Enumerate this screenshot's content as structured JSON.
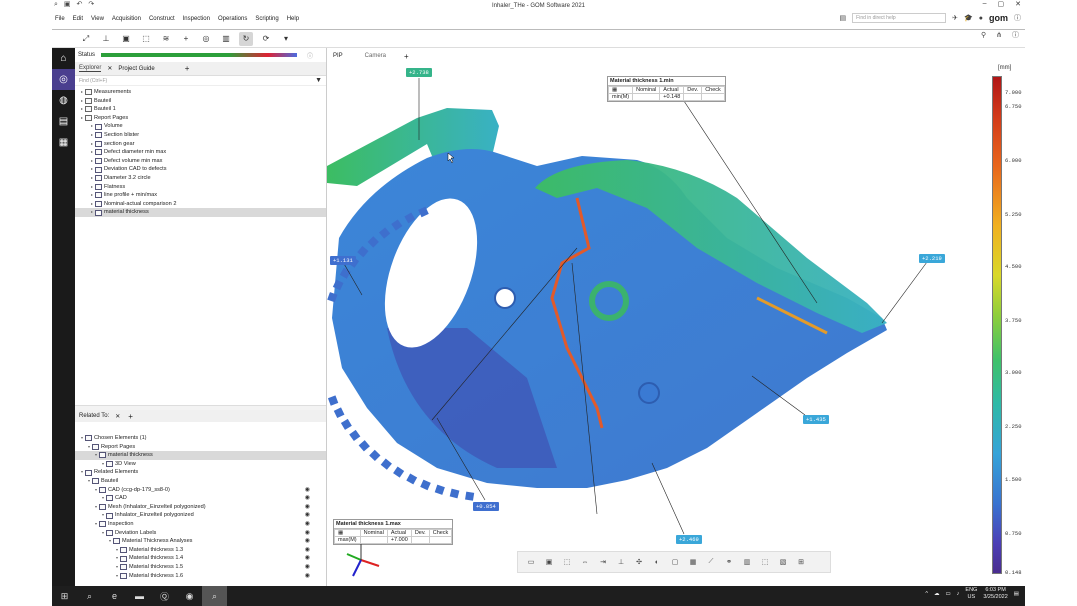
{
  "window": {
    "title": "Inhaler_THe - GOM Software 2021"
  },
  "menu": {
    "items": [
      "File",
      "Edit",
      "View",
      "Acquisition",
      "Construct",
      "Inspection",
      "Operations",
      "Scripting",
      "Help"
    ],
    "search_placeholder": "Find in direct help",
    "logo": "gom"
  },
  "status": {
    "label": "Status"
  },
  "tabs": {
    "explorer": "Explorer",
    "project_guide": "Project Guide"
  },
  "find": {
    "placeholder": "Find (Ctrl+F)"
  },
  "explorer_tree": [
    {
      "label": "Measurements",
      "level": 0
    },
    {
      "label": "Bauteil",
      "level": 0
    },
    {
      "label": "Bauteil 1",
      "level": 0
    },
    {
      "label": "Report Pages",
      "level": 0
    },
    {
      "label": "Volume",
      "level": 1
    },
    {
      "label": "Section blister",
      "level": 1
    },
    {
      "label": "section gear",
      "level": 1
    },
    {
      "label": "Defect diameter min max",
      "level": 1
    },
    {
      "label": "Defect volume min max",
      "level": 1
    },
    {
      "label": "Deviation CAD to defects",
      "level": 1
    },
    {
      "label": "Diameter 3.2 circle",
      "level": 1
    },
    {
      "label": "Flatness",
      "level": 1
    },
    {
      "label": "line profile + min/max",
      "level": 1
    },
    {
      "label": "Nominal-actual comparison 2",
      "level": 1
    },
    {
      "label": "material thickness",
      "level": 1,
      "selected": true
    }
  ],
  "related": {
    "title": "Related To:"
  },
  "related_tree": [
    {
      "label": "Chosen Elements (1)",
      "level": 0
    },
    {
      "label": "Report Pages",
      "level": 1
    },
    {
      "label": "material thickness",
      "level": 2,
      "selected": true
    },
    {
      "label": "3D View",
      "level": 3
    },
    {
      "label": "Related Elements",
      "level": 0
    },
    {
      "label": "Bauteil",
      "level": 1
    },
    {
      "label": "CAD (ccg-dp-179_ss8-0)",
      "level": 2
    },
    {
      "label": "CAD",
      "level": 3
    },
    {
      "label": "Mesh (Inhalator_Einzelteil polygonized)",
      "level": 2
    },
    {
      "label": "Inhalator_Einzelteil polygonized",
      "level": 3
    },
    {
      "label": "Inspection",
      "level": 2
    },
    {
      "label": "Deviation Labels",
      "level": 3
    },
    {
      "label": "Material Thickness Analyses",
      "level": 4
    },
    {
      "label": "Material thickness 1.3",
      "level": 5
    },
    {
      "label": "Material thickness 1.4",
      "level": 5
    },
    {
      "label": "Material thickness 1.5",
      "level": 5
    },
    {
      "label": "Material thickness 1.6",
      "level": 5
    }
  ],
  "view": {
    "tabs": [
      "PIP",
      "Camera"
    ]
  },
  "labels": {
    "l1": "+2.738",
    "l2": "+1.131",
    "l3": "+0.854",
    "l4": "+2.469",
    "l5": "+1.435",
    "l6": "+2.219"
  },
  "table_min": {
    "title": "Material thickness 1.min",
    "cols": [
      "Nominal",
      "Actual",
      "Dev.",
      "Check"
    ],
    "row_label": "min(M)",
    "actual": "+0.148"
  },
  "table_max": {
    "title": "Material thickness 1.max",
    "cols": [
      "Nominal",
      "Actual",
      "Dev.",
      "Check"
    ],
    "row_label": "max(M)",
    "actual": "+7.000"
  },
  "legend": {
    "unit": "[mm]",
    "ticks": [
      "7.000",
      "6.750",
      "6.000",
      "5.250",
      "4.500",
      "3.750",
      "3.000",
      "2.250",
      "1.500",
      "0.750",
      "0.148"
    ]
  },
  "taskbar": {
    "lang1": "ENG",
    "lang2": "US",
    "time": "6:03 PM",
    "date": "3/25/2022"
  },
  "colors": {
    "accent": "#4a3f8f",
    "part_blue": "#3d7fd3",
    "part_green": "#3cc06a"
  }
}
